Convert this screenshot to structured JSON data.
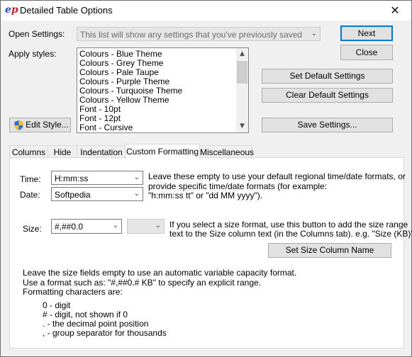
{
  "window": {
    "title": "Detailed Table Options",
    "icon_text_e": "e",
    "icon_text_p": "p"
  },
  "open_settings": {
    "label": "Open Settings:",
    "value": "This list will show any settings that you've previously saved"
  },
  "apply_styles": {
    "label": "Apply styles:",
    "items": [
      "Colours - Blue Theme",
      "Colours - Grey Theme",
      "Colours - Pale Taupe",
      "Colours - Purple Theme",
      "Colours - Turquoise Theme",
      "Colours - Yellow Theme",
      "Font - 10pt",
      "Font - 12pt",
      "Font - Cursive"
    ]
  },
  "buttons": {
    "next": "Next",
    "close": "Close",
    "set_default": "Set Default Settings",
    "clear_default": "Clear Default Settings",
    "save_settings": "Save Settings...",
    "edit_style": "Edit Style...",
    "set_size_column": "Set Size Column Name"
  },
  "tabs": [
    "Columns",
    "Hide",
    "Indentation",
    "Custom Formatting",
    "Miscellaneous"
  ],
  "active_tab": "Custom Formatting",
  "custom_formatting": {
    "time_label": "Time:",
    "time_value": "H:mm:ss",
    "date_label": "Date:",
    "date_value": "Softpedia",
    "datetime_help_1": "Leave these empty to use your default regional time/date formats, or",
    "datetime_help_2": "provide specific time/date formats (for example:",
    "datetime_help_3": "\"h:mm:ss tt\" or \"dd MM yyyy\").",
    "size_label": "Size:",
    "size_value": "#,##0.0",
    "size_unit_value": "",
    "size_help_1": "If you select a size format, use this button to add the size range",
    "size_help_2": "text to the Size column text (in the Columns tab). e.g. \"Size (KB)\".",
    "notes": [
      "Leave the size fields empty to use an automatic variable capacity format.",
      "Use a format such as: \"#,##0.# KB\" to specify an explicit range.",
      "Formatting characters are:"
    ],
    "chars": [
      "0 - digit",
      "# - digit, not shown if 0",
      ". - the decimal point position",
      ", - group separator for thousands"
    ]
  },
  "colors": {
    "accent": "#0078d7",
    "window_bg": "#f0f0f0",
    "panel_bg": "#ffffff"
  }
}
